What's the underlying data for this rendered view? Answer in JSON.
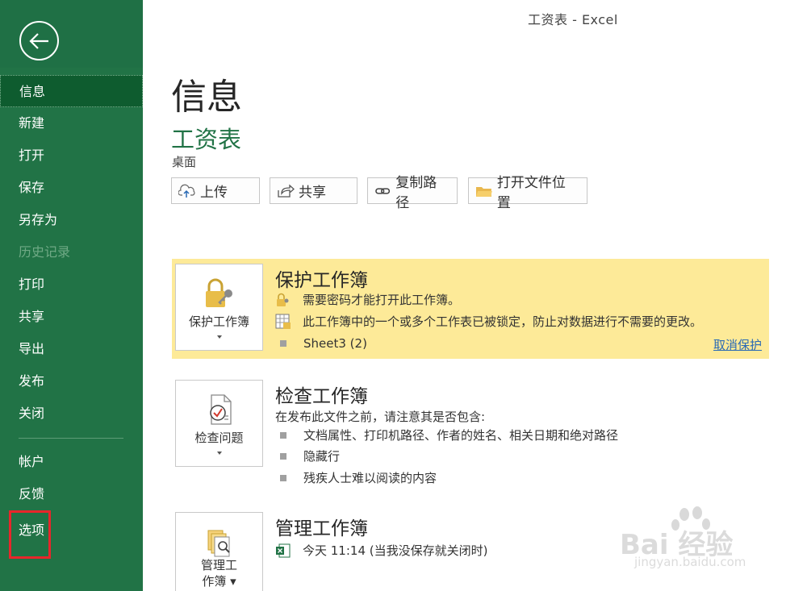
{
  "window": {
    "title": "工资表  -  Excel"
  },
  "sidebar": {
    "items": [
      {
        "label": "信息"
      },
      {
        "label": "新建"
      },
      {
        "label": "打开"
      },
      {
        "label": "保存"
      },
      {
        "label": "另存为"
      },
      {
        "label": "历史记录"
      },
      {
        "label": "打印"
      },
      {
        "label": "共享"
      },
      {
        "label": "导出"
      },
      {
        "label": "发布"
      },
      {
        "label": "关闭"
      },
      {
        "label": "帐户"
      },
      {
        "label": "反馈"
      },
      {
        "label": "选项"
      }
    ]
  },
  "main": {
    "title": "信息",
    "file_name": "工资表",
    "file_location": "桌面",
    "buttons": {
      "upload": "上传",
      "share": "共享",
      "copy_path": "复制路径",
      "open_location": "打开文件位置"
    }
  },
  "protect": {
    "button_label": "保护工作簿",
    "title": "保护工作簿",
    "line1": "需要密码才能打开此工作簿。",
    "line2": "此工作簿中的一个或多个工作表已被锁定，防止对数据进行不需要的更改。",
    "sheet": "Sheet3 (2)",
    "link": "取消保护"
  },
  "inspect": {
    "button_label": "检查问题",
    "title": "检查工作簿",
    "intro": "在发布此文件之前，请注意其是否包含:",
    "items": [
      "文档属性、打印机路径、作者的姓名、相关日期和绝对路径",
      "隐藏行",
      "残疾人士难以阅读的内容"
    ]
  },
  "manage": {
    "button_label_1": "管理工",
    "button_label_2": "作簿",
    "title": "管理工作簿",
    "version": "今天 11:14 (当我没保存就关闭时)"
  },
  "watermark": {
    "brand": "Bai  经验",
    "url": "jingyan.baidu.com"
  },
  "colors": {
    "sidebar": "#217346",
    "active": "#0e5c2f",
    "protect_bg": "#fdea98",
    "accent": "#217346",
    "highlight": "#e8262b"
  }
}
